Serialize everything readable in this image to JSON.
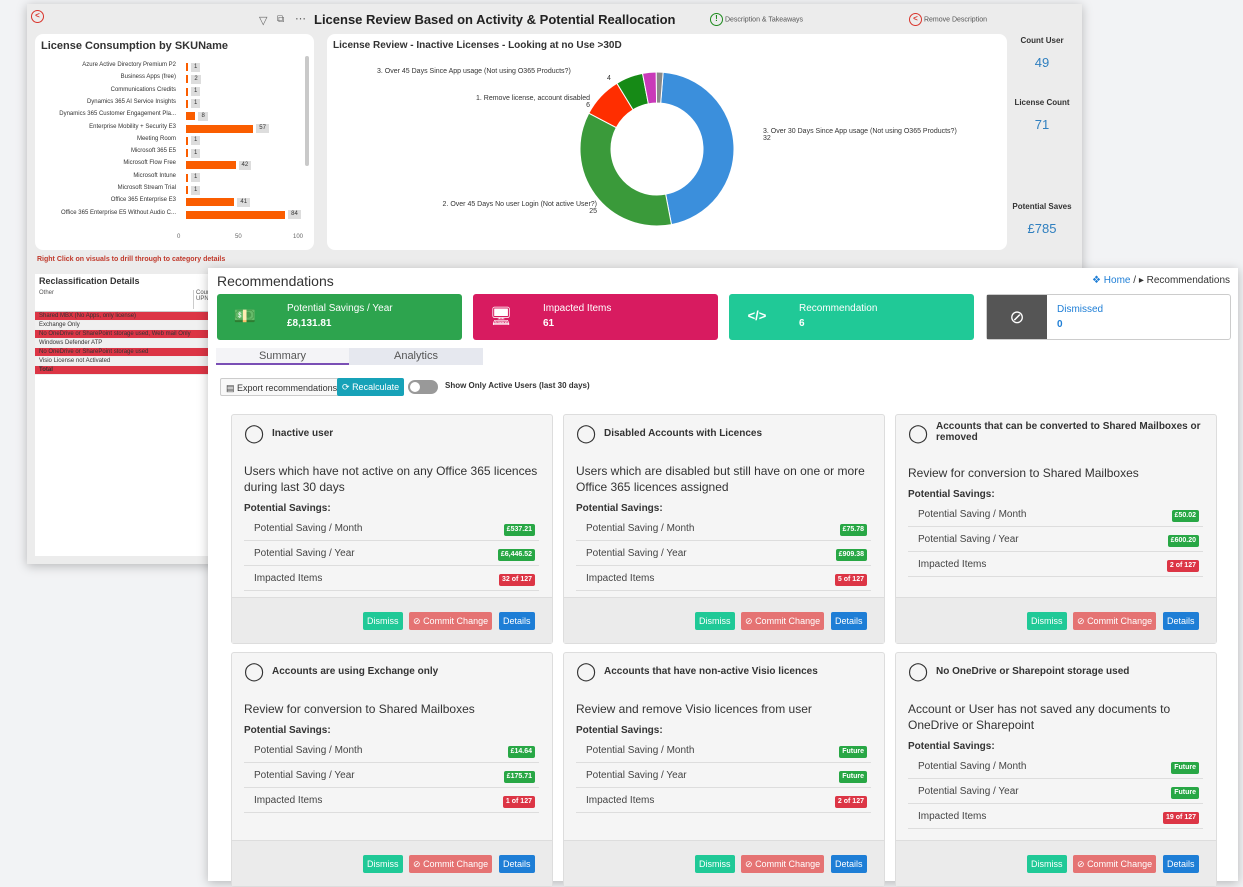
{
  "powerbi": {
    "title": "License Review Based on Activity & Potential Reallocation",
    "desc_label": "Description & Takeaways",
    "remove_label": "Remove Description",
    "sku_title": "License Consumption by SKUName",
    "sku_rows": [
      {
        "name": "Azure Active Directory Premium P2",
        "value": 1
      },
      {
        "name": "Business Apps (free)",
        "value": 2
      },
      {
        "name": "Communications Credits",
        "value": 1
      },
      {
        "name": "Dynamics 365 AI Service Insights",
        "value": 1
      },
      {
        "name": "Dynamics 365 Customer Engagement Pla...",
        "value": 8
      },
      {
        "name": "Enterprise Mobility + Security E3",
        "value": 57
      },
      {
        "name": "Meeting Room",
        "value": 1
      },
      {
        "name": "Microsoft 365 E5",
        "value": 1
      },
      {
        "name": "Microsoft Flow Free",
        "value": 42
      },
      {
        "name": "Microsoft Intune",
        "value": 1
      },
      {
        "name": "Microsoft Stream Trial",
        "value": 1
      },
      {
        "name": "Office 365 Enterprise E3",
        "value": 41
      },
      {
        "name": "Office 365 Enterprise E5 Without Audio C...",
        "value": 84
      }
    ],
    "sku_ticks": [
      "0",
      "50",
      "100"
    ],
    "donut_title": "License Review - Inactive Licenses - Looking at no Use >30D",
    "donut_labels": {
      "a": "3. Over 45 Days Since App usage (Not using O365 Products?)",
      "a_v": "4",
      "b": "1. Remove license, account disabled",
      "b_v": "6",
      "c": "3. Over 30 Days Since App usage (Not using O365 Products?)",
      "c_v": "32",
      "d": "2. Over 45 Days No user Login (Not active User?)",
      "d_v": "25"
    },
    "kpis": [
      {
        "label": "Count User",
        "value": "49"
      },
      {
        "label": "License Count",
        "value": "71"
      },
      {
        "label": "Potential Saves",
        "value": "£785"
      }
    ],
    "hint": "Right Click on visuals to drill through to category details",
    "recl_title": "Reclassification Details",
    "recl_head": [
      "Other",
      "Cour UPN"
    ],
    "recl_rows": [
      "Shared MBX (No Apps, only license)",
      "Exchange Only",
      "No OneDrive or SharePoint storage used, Web mail Only",
      "Windows Defender ATP",
      "No OneDrive or SharePoint storage used",
      "Visio License not Activated",
      "Total"
    ]
  },
  "chart_data": [
    {
      "type": "bar",
      "title": "License Consumption by SKUName",
      "categories": [
        "Azure Active Directory Premium P2",
        "Business Apps (free)",
        "Communications Credits",
        "Dynamics 365 AI Service Insights",
        "Dynamics 365 Customer Engagement Pla...",
        "Enterprise Mobility + Security E3",
        "Meeting Room",
        "Microsoft 365 E5",
        "Microsoft Flow Free",
        "Microsoft Intune",
        "Microsoft Stream Trial",
        "Office 365 Enterprise E3",
        "Office 365 Enterprise E5 Without Audio C..."
      ],
      "values": [
        1,
        2,
        1,
        1,
        8,
        57,
        1,
        1,
        42,
        1,
        1,
        41,
        84
      ],
      "xlim": [
        0,
        100
      ]
    },
    {
      "type": "pie",
      "title": "License Review - Inactive Licenses - Looking at no Use >30D",
      "labels": [
        "3. Over 30 Days Since App usage (Not using O365 Products?)",
        "2. Over 45 Days No user Login (Not active User?)",
        "1. Remove license, account disabled",
        "3. Over 45 Days Since App usage (Not using O365 Products?)",
        "",
        ""
      ],
      "values": [
        32,
        25,
        6,
        4,
        2,
        1
      ],
      "colors": [
        "#3b8fdc",
        "#3a9a3a",
        "#ff2e00",
        "#168a16",
        "#c93ab9",
        "#8a8a8a"
      ]
    }
  ],
  "rec": {
    "title": "Recommendations",
    "crumb_home": "Home",
    "crumb_current": "Recommendations",
    "tiles": [
      {
        "label": "Potential Savings / Year",
        "value": "£8,131.81",
        "color": "#2da44e"
      },
      {
        "label": "Impacted Items",
        "value": "61",
        "color": "#d81b60"
      },
      {
        "label": "Recommendation",
        "value": "6",
        "color": "#20c997"
      },
      {
        "label": "Dismissed",
        "value": "0"
      }
    ],
    "tabs": [
      "Summary",
      "Analytics"
    ],
    "export": "Export recommendations",
    "recalc": "Recalculate",
    "toggle": "Show Only Active Users (last 30 days)",
    "ps_label": "Potential Savings:",
    "row_labels": [
      "Potential Saving / Month",
      "Potential Saving / Year",
      "Impacted Items"
    ],
    "dismiss": "Dismiss",
    "commit": "Commit Change",
    "details": "Details",
    "cards": [
      {
        "title": "Inactive user",
        "desc": "Users which have not active on any Office 365 licences during last 30 days",
        "month": "£537.21",
        "year": "£6,446.52",
        "items": "32 of 127"
      },
      {
        "title": "Disabled Accounts with Licences",
        "desc": "Users which are disabled but still have on one or more Office 365 licences assigned",
        "month": "£75.78",
        "year": "£909.38",
        "items": "5 of 127"
      },
      {
        "title": "Accounts that can be converted to Shared Mailboxes or removed",
        "desc": "Review for conversion to Shared Mailboxes",
        "month": "£50.02",
        "year": "£600.20",
        "items": "2 of 127"
      },
      {
        "title": "Accounts are using Exchange only",
        "desc": "Review for conversion to Shared Mailboxes",
        "month": "£14.64",
        "year": "£175.71",
        "items": "1 of 127"
      },
      {
        "title": "Accounts that have non-active Visio licences",
        "desc": "Review and remove Visio licences from user",
        "month": "Future",
        "year": "Future",
        "items": "2 of 127"
      },
      {
        "title": "No OneDrive or Sharepoint storage used",
        "desc": "Account or User has not saved any documents to OneDrive or Sharepoint",
        "month": "Future",
        "year": "Future",
        "items": "19 of 127"
      }
    ]
  }
}
